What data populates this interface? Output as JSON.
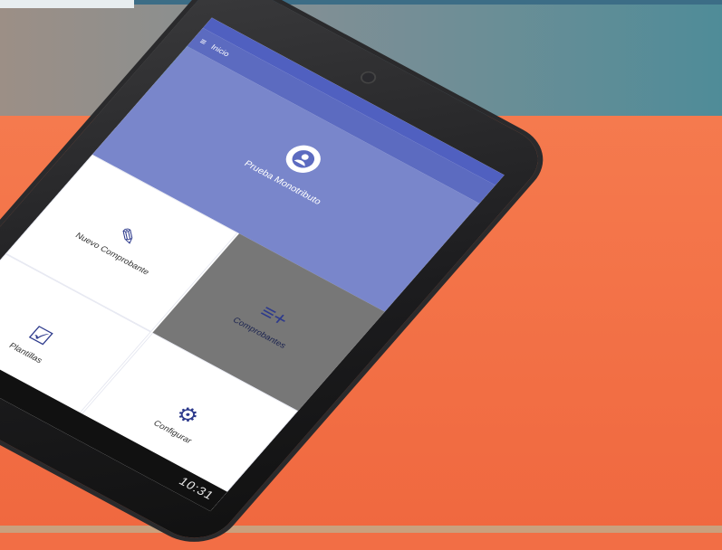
{
  "app": {
    "title": "Inicio"
  },
  "profile": {
    "name": "Prueba Monotributo"
  },
  "tiles": {
    "comprobantes": "Comprobantes",
    "nuevo_comprobante": "Nuevo Comprobante",
    "configurar": "Configurar",
    "plantillas": "Plantillas"
  },
  "system": {
    "clock": "10:31"
  },
  "icons": {
    "menu": "menu-icon",
    "avatar": "account-circle-icon",
    "list_add": "playlist-add-icon",
    "pencil": "pencil-icon",
    "gear": "gear-icon",
    "clipboard": "clipboard-check-icon"
  },
  "colors": {
    "primary": "#5c6bc0",
    "primary_light": "#7986cb",
    "accent_bg": "#f26e45",
    "tile_gray": "#777777"
  }
}
